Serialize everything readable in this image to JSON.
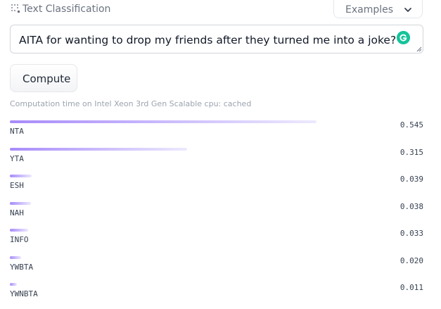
{
  "header": {
    "task_title": "Text Classification",
    "task_icon": "text-classification-icon",
    "examples_label": "Examples",
    "examples_icon": "chevron-down-icon"
  },
  "input": {
    "value": "AITA for wanting to drop my friends after they turned me into a joke?",
    "grammarly_icon": "grammarly-icon",
    "grammarly_color": "#15c39a"
  },
  "compute": {
    "label": "Compute"
  },
  "computation_time": "Computation time on Intel Xeon 3rd Gen Scalable cpu: cached",
  "colors": {
    "bar_start": "#a78bfa",
    "bar_end": "#ede9fe"
  },
  "results": [
    {
      "label": "NTA",
      "score": "0.545",
      "value": 0.545
    },
    {
      "label": "YTA",
      "score": "0.315",
      "value": 0.315
    },
    {
      "label": "ESH",
      "score": "0.039",
      "value": 0.039
    },
    {
      "label": "NAH",
      "score": "0.038",
      "value": 0.038
    },
    {
      "label": "INFO",
      "score": "0.033",
      "value": 0.033
    },
    {
      "label": "YWBTA",
      "score": "0.020",
      "value": 0.02
    },
    {
      "label": "YWNBTA",
      "score": "0.011",
      "value": 0.011
    }
  ]
}
